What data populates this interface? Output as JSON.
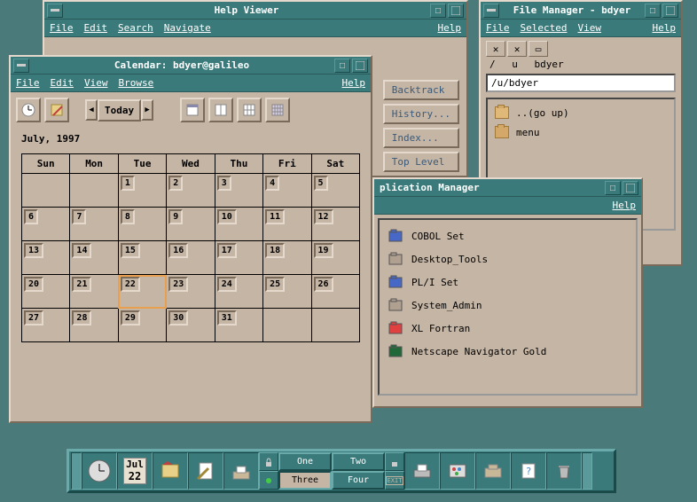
{
  "help_viewer": {
    "title": "Help Viewer",
    "menu": {
      "file": "File",
      "edit": "Edit",
      "search": "Search",
      "navigate": "Navigate",
      "help": "Help"
    },
    "side_buttons": {
      "backtrack": "Backtrack",
      "history": "History...",
      "index": "Index...",
      "top": "Top Level"
    }
  },
  "file_manager": {
    "title": "File Manager - bdyer",
    "menu": {
      "file": "File",
      "selected": "Selected",
      "view": "View",
      "help": "Help"
    },
    "breadcrumb": [
      "/",
      "u",
      "bdyer"
    ],
    "path": "/u/bdyer",
    "items": [
      {
        "name": "..(go up)"
      },
      {
        "name": "menu"
      }
    ]
  },
  "calendar": {
    "title": "Calendar: bdyer@galileo",
    "menu": {
      "file": "File",
      "edit": "Edit",
      "view": "View",
      "browse": "Browse",
      "help": "Help"
    },
    "today_label": "Today",
    "month_label": "July, 1997",
    "day_headers": [
      "Sun",
      "Mon",
      "Tue",
      "Wed",
      "Thu",
      "Fri",
      "Sat"
    ],
    "weeks": [
      [
        "",
        "",
        "1",
        "2",
        "3",
        "4",
        "5"
      ],
      [
        "6",
        "7",
        "8",
        "9",
        "10",
        "11",
        "12"
      ],
      [
        "13",
        "14",
        "15",
        "16",
        "17",
        "18",
        "19"
      ],
      [
        "20",
        "21",
        "22",
        "23",
        "24",
        "25",
        "26"
      ],
      [
        "27",
        "28",
        "29",
        "30",
        "31",
        "",
        ""
      ]
    ],
    "selected_day": "22"
  },
  "app_manager": {
    "title": "plication Manager",
    "menu": {
      "help": "Help"
    },
    "items": [
      {
        "name": "COBOL Set",
        "color": "#4868c8"
      },
      {
        "name": "Desktop_Tools",
        "color": "#b0a090"
      },
      {
        "name": "PL/I Set",
        "color": "#4868c8"
      },
      {
        "name": "System_Admin",
        "color": "#b0a090"
      },
      {
        "name": "XL Fortran",
        "color": "#e04040"
      },
      {
        "name": "Netscape Navigator Gold",
        "color": "#206838"
      }
    ]
  },
  "dock": {
    "date_month": "Jul",
    "date_day": "22",
    "workspaces": [
      {
        "name": "One",
        "active": false
      },
      {
        "name": "Two",
        "active": false
      },
      {
        "name": "Three",
        "active": true
      },
      {
        "name": "Four",
        "active": false
      }
    ]
  }
}
